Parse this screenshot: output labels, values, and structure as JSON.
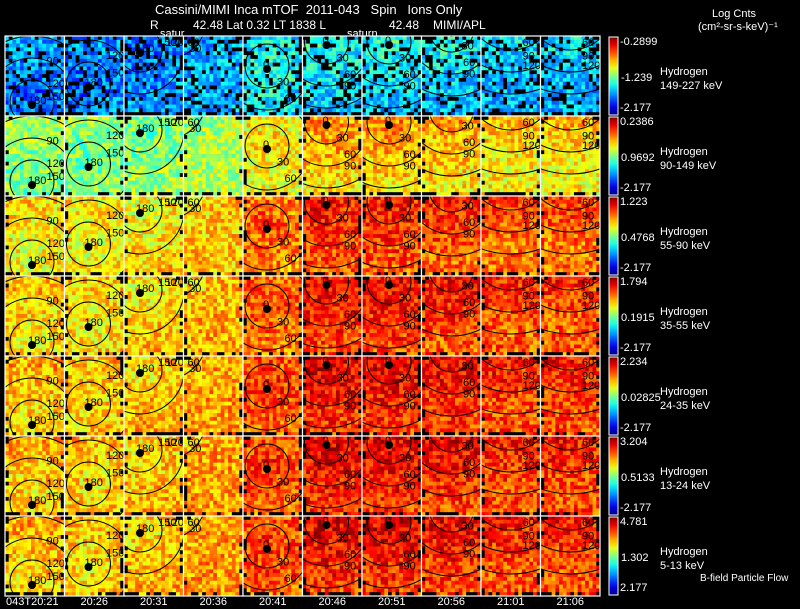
{
  "header": {
    "title": "Cassini/MIMI Inca mTOF  2011-043   Spin   Ions Only",
    "r_label": "R",
    "position_line": "42.48 Lat 0.32 LT 1838 L",
    "l_value": "42.48",
    "credit": "MIMI/APL",
    "saturn_labels": [
      "satur",
      "saturn"
    ]
  },
  "colorbar_title": {
    "line1": "Log Cnts",
    "line2": "(cm²-sr-s-keV)⁻¹"
  },
  "footer_note": "B-field Particle Flow",
  "chart_data": {
    "type": "heatmap",
    "colormap": "jet",
    "colorbar_direction": "blue-low to red-high",
    "x_tick_labels": [
      "043T20:21",
      "20:26",
      "20:31",
      "20:36",
      "20:41",
      "20:46",
      "20:51",
      "20:56",
      "21:01",
      "21:06"
    ],
    "columns": [
      {
        "center_label": "180",
        "contour_labels": [
          "90",
          "120",
          "150"
        ]
      },
      {
        "center_label": "180",
        "contour_labels": [
          "120",
          "150"
        ]
      },
      {
        "center_label": "180",
        "contour_labels": [
          "150",
          "120"
        ]
      },
      {
        "center_label": "",
        "contour_labels": [
          "60",
          "30"
        ]
      },
      {
        "center_label": "0",
        "contour_labels": [
          "30",
          "60"
        ]
      },
      {
        "center_label": "0",
        "contour_labels": [
          "30",
          "60",
          "90"
        ]
      },
      {
        "center_label": "0",
        "contour_labels": [
          "30",
          "60",
          "90"
        ]
      },
      {
        "center_label": "0",
        "contour_labels": [
          "30",
          "60",
          "90"
        ]
      },
      {
        "center_label": "",
        "contour_labels": [
          "60",
          "90",
          "120"
        ]
      },
      {
        "center_label": "",
        "contour_labels": [
          "60",
          "90",
          "120"
        ]
      }
    ],
    "rows": [
      {
        "species": "Hydrogen",
        "energy": "149-227 keV",
        "cbar_max": "-0.2899",
        "cbar_mid": "-1.239",
        "cbar_min": "-2.177",
        "level": 0.3
      },
      {
        "species": "Hydrogen",
        "energy": "90-149 keV",
        "cbar_max": "0.2386",
        "cbar_mid": "0.9692",
        "cbar_min": "-2.177",
        "level": 0.55
      },
      {
        "species": "Hydrogen",
        "energy": "55-90 keV",
        "cbar_max": "1.223",
        "cbar_mid": "0.4768",
        "cbar_min": "-2.177",
        "level": 0.68
      },
      {
        "species": "Hydrogen",
        "energy": "35-55 keV",
        "cbar_max": "1.794",
        "cbar_mid": "0.1915",
        "cbar_min": "-2.177",
        "level": 0.7
      },
      {
        "species": "Hydrogen",
        "energy": "24-35 keV",
        "cbar_max": "2.234",
        "cbar_mid": "0.02825",
        "cbar_min": "-2.177",
        "level": 0.72
      },
      {
        "species": "Hydrogen",
        "energy": "13-24 keV",
        "cbar_max": "3.204",
        "cbar_mid": "0.5133",
        "cbar_min": "-2.177",
        "level": 0.72
      },
      {
        "species": "Hydrogen",
        "energy": "5-13 keV",
        "cbar_max": "4.781",
        "cbar_mid": "1.302",
        "cbar_min": "2.177",
        "level": 0.72
      }
    ]
  }
}
